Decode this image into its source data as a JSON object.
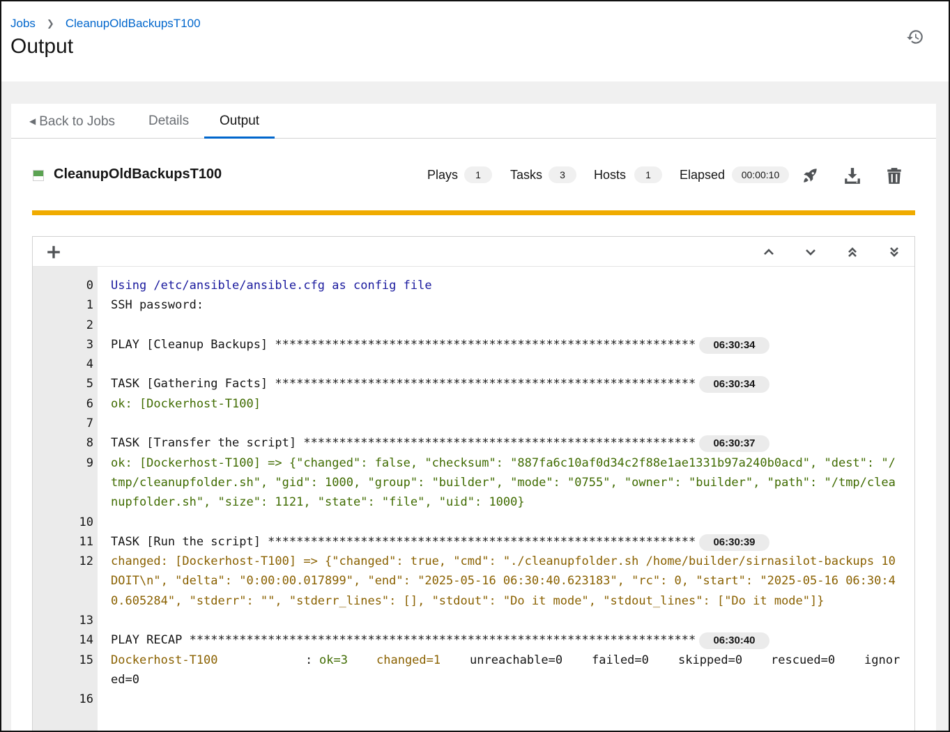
{
  "breadcrumb": {
    "jobs": "Jobs",
    "current": "CleanupOldBackupsT100"
  },
  "page_title": "Output",
  "tabs": {
    "back": "Back to Jobs",
    "details": "Details",
    "output": "Output"
  },
  "job": {
    "name": "CleanupOldBackupsT100",
    "plays_label": "Plays",
    "plays": "1",
    "tasks_label": "Tasks",
    "tasks": "3",
    "hosts_label": "Hosts",
    "hosts": "1",
    "elapsed_label": "Elapsed",
    "elapsed": "00:00:10"
  },
  "colors": {
    "accent": "#0066cc",
    "progress": "#f0ab00",
    "success": "#5ba352"
  },
  "icons": [
    "history-icon",
    "rocket-icon",
    "download-icon",
    "delete-icon",
    "plus-icon",
    "chevron-up-icon",
    "chevron-down-icon",
    "double-chevron-up-icon",
    "double-chevron-down-icon"
  ],
  "lines": {
    "l0": "Using /etc/ansible/ansible.cfg as config file",
    "l1": "SSH password:",
    "l3": "PLAY [Cleanup Backups] ***********************************************************",
    "t3": "06:30:34",
    "l5": "TASK [Gathering Facts] ***********************************************************",
    "t5": "06:30:34",
    "l6": "ok: [Dockerhost-T100]",
    "l8": "TASK [Transfer the script] *******************************************************",
    "t8": "06:30:37",
    "l9": "ok: [Dockerhost-T100] => {\"changed\": false, \"checksum\": \"887fa6c10af0d34c2f88e1ae1331b97a240b0acd\", \"dest\": \"/tmp/cleanupfolder.sh\", \"gid\": 1000, \"group\": \"builder\", \"mode\": \"0755\", \"owner\": \"builder\", \"path\": \"/tmp/cleanupfolder.sh\", \"size\": 1121, \"state\": \"file\", \"uid\": 1000}",
    "l11": "TASK [Run the script] ************************************************************",
    "t11": "06:30:39",
    "l12": "changed: [Dockerhost-T100] => {\"changed\": true, \"cmd\": \"./cleanupfolder.sh /home/builder/sirnasilot-backups 10 DOIT\\n\", \"delta\": \"0:00:00.017899\", \"end\": \"2025-05-16 06:30:40.623183\", \"rc\": 0, \"start\": \"2025-05-16 06:30:40.605284\", \"stderr\": \"\", \"stderr_lines\": [], \"stdout\": \"Do it mode\", \"stdout_lines\": [\"Do it mode\"]}",
    "l14": "PLAY RECAP ***********************************************************************",
    "t14": "06:30:40",
    "recap_host": "Dockerhost-T100",
    "recap_colon": ":",
    "recap_ok": "ok=3",
    "recap_changed": "changed=1",
    "recap_unreachable": "unreachable=0",
    "recap_failed": "failed=0",
    "recap_skipped": "skipped=0",
    "recap_rescued": "rescued=0",
    "recap_ignored": "ignored=0"
  },
  "line_numbers": [
    "0",
    "1",
    "2",
    "3",
    "4",
    "5",
    "6",
    "7",
    "8",
    "9",
    "10",
    "11",
    "12",
    "13",
    "14",
    "15",
    "16"
  ]
}
